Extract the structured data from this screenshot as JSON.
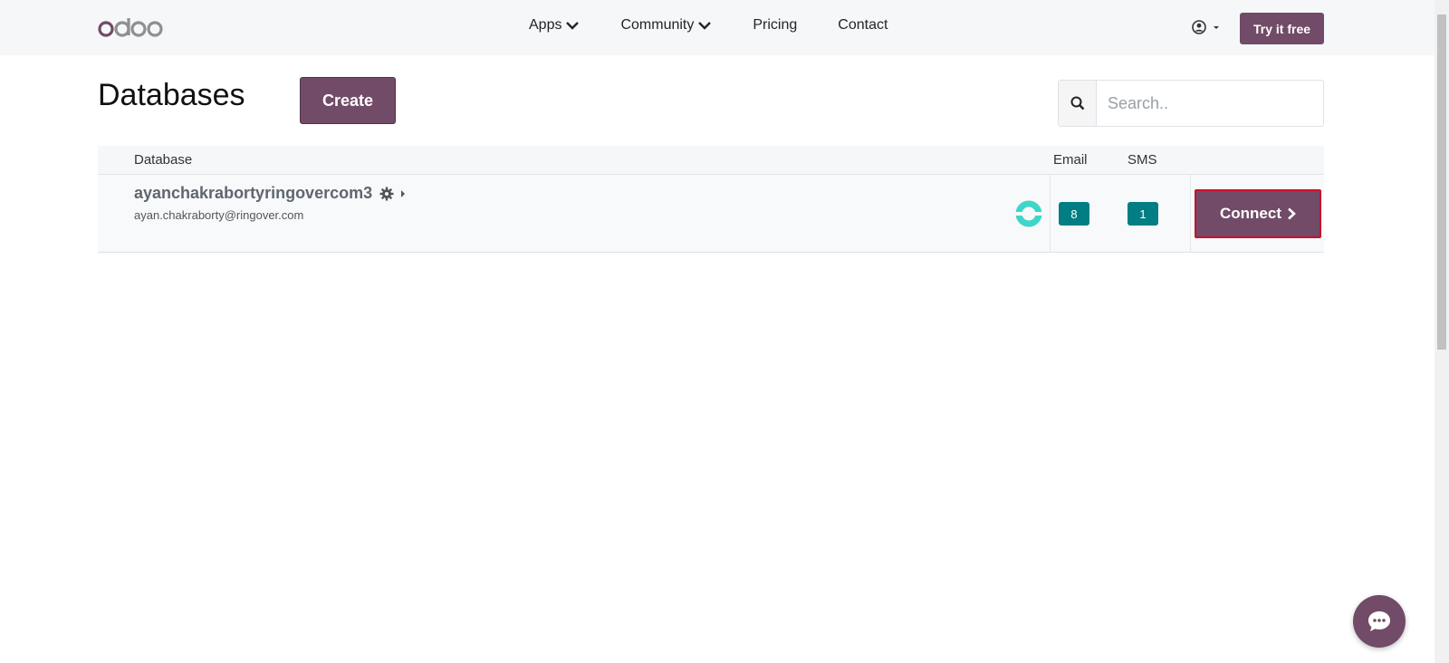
{
  "navbar": {
    "logo": "odoo",
    "links": [
      {
        "label": "Apps",
        "dropdown": true
      },
      {
        "label": "Community",
        "dropdown": true
      },
      {
        "label": "Pricing",
        "dropdown": false
      },
      {
        "label": "Contact",
        "dropdown": false
      }
    ],
    "try_label": "Try it free"
  },
  "page": {
    "title": "Databases",
    "create_label": "Create",
    "search_placeholder": "Search.."
  },
  "table": {
    "headers": {
      "database": "Database",
      "email": "Email",
      "sms": "SMS"
    },
    "rows": [
      {
        "name": "ayanchakrabortyringovercom3",
        "owner_email": "ayan.chakraborty@ringover.com",
        "email_count": "8",
        "sms_count": "1",
        "connect_label": "Connect"
      }
    ]
  },
  "colors": {
    "brand": "#714b67",
    "badge": "#017e84",
    "status": "#3ed6c8"
  },
  "icons": [
    "user-circle-icon",
    "caret-down-icon",
    "chevron-down-icon",
    "search-icon",
    "gear-icon",
    "caret-right-icon",
    "status-ring-icon",
    "chevron-right-icon",
    "chat-bubble-icon"
  ]
}
